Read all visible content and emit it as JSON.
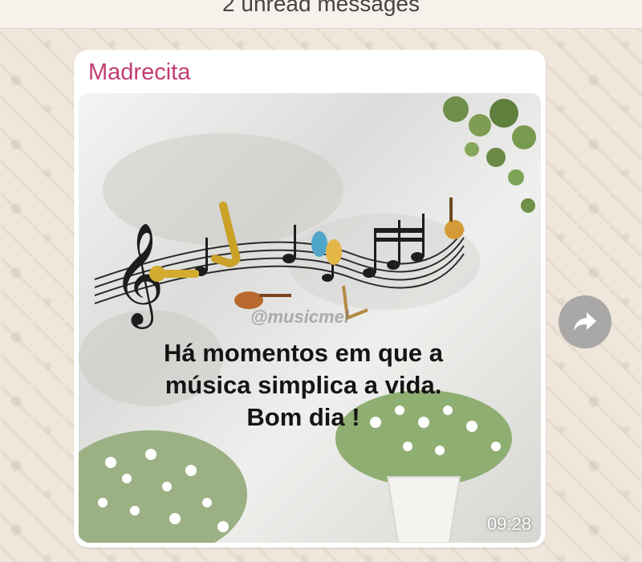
{
  "header": {
    "unread_text": "2 unread messages"
  },
  "message": {
    "sender": "Madrecita",
    "image": {
      "watermark": "@musicmel",
      "caption_lines": [
        "Há momentos em que a",
        "música simplica a vida.",
        "Bom dia !"
      ]
    },
    "time": "09:28"
  },
  "icons": {
    "forward": "forward-arrow-icon"
  },
  "colors": {
    "sender": "#c23d72",
    "wallpaper": "#efe7dc",
    "bubble": "#ffffff",
    "forward_button": "#a9a8a6"
  }
}
